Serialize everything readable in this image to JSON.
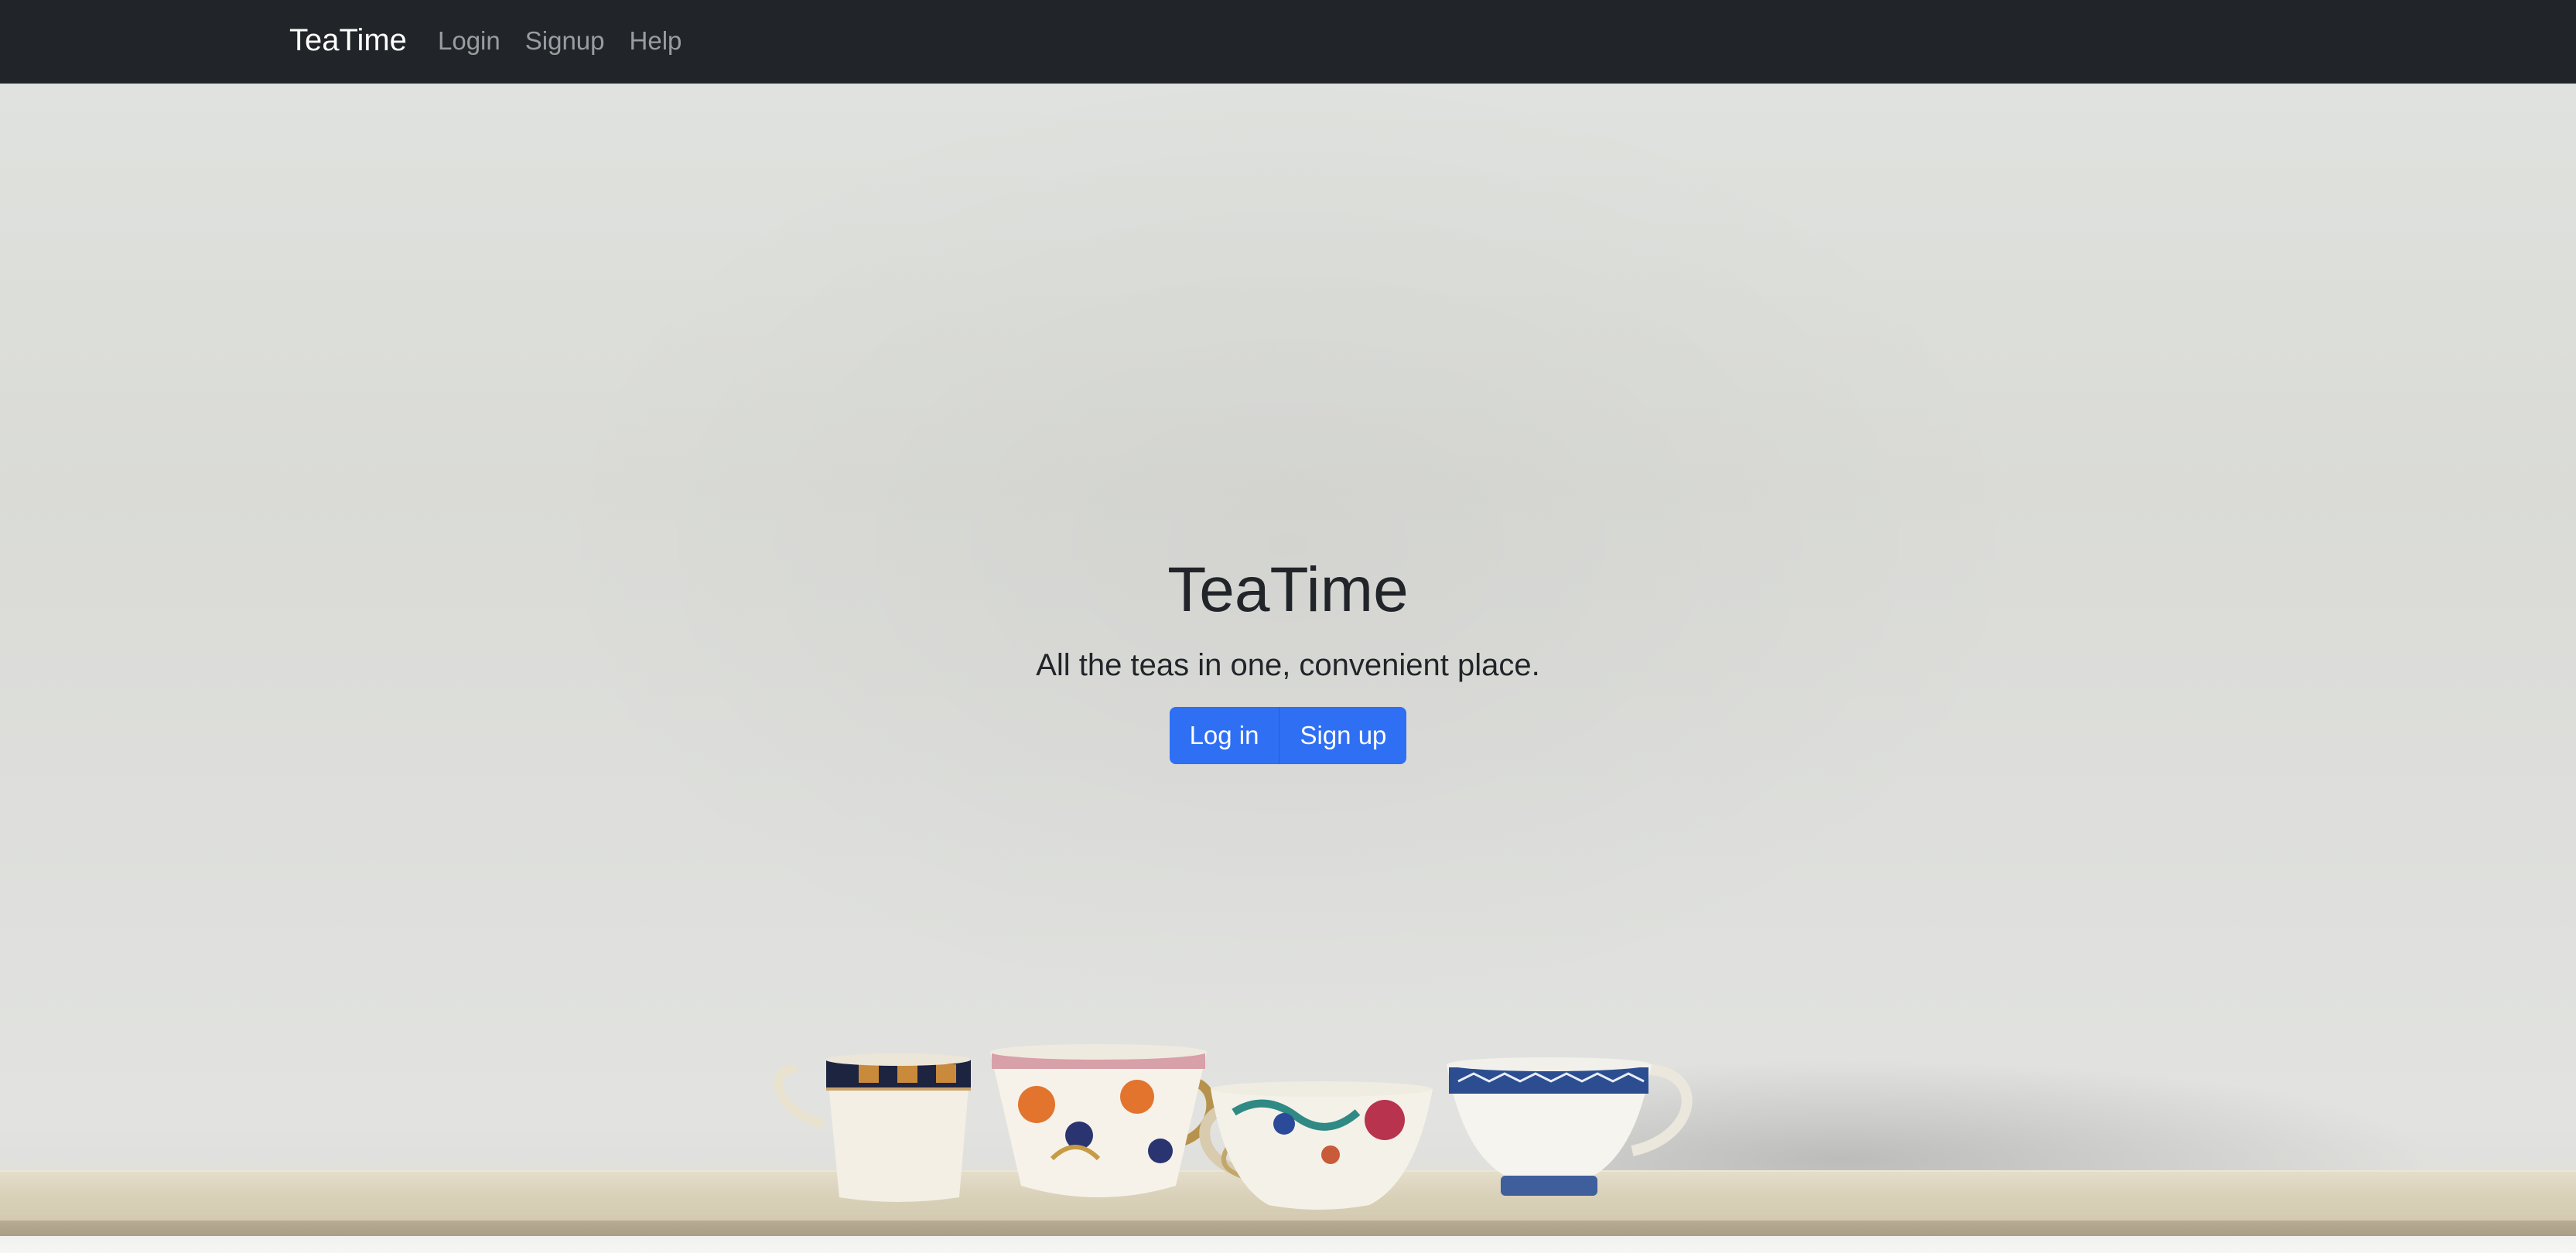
{
  "navbar": {
    "brand": "TeaTime",
    "links": [
      {
        "label": "Login"
      },
      {
        "label": "Signup"
      },
      {
        "label": "Help"
      }
    ]
  },
  "hero": {
    "title": "TeaTime",
    "subtitle": "All the teas in one, convenient place.",
    "buttons": {
      "login": "Log in",
      "signup": "Sign up"
    },
    "image_subject": "four-vintage-teacups-on-shelf"
  },
  "colors": {
    "navbar_bg": "#212529",
    "primary_button": "#2f6ff4",
    "hero_bg": "#dcdedb",
    "shelf": "#d9d0b8"
  }
}
